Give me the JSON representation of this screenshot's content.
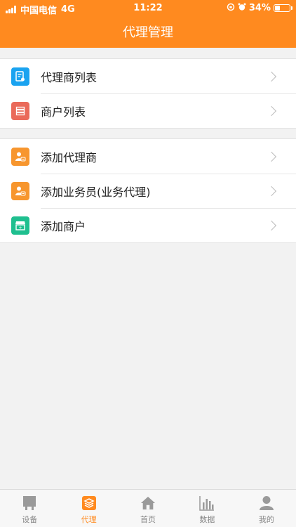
{
  "status_bar": {
    "carrier": "中国电信",
    "network": "4G",
    "time": "11:22",
    "battery": "34%",
    "battery_level": 0.34
  },
  "header": {
    "title": "代理管理"
  },
  "groups": [
    {
      "items": [
        {
          "label": "代理商列表",
          "icon": "agent-list-icon",
          "color": "#1aa3f0"
        },
        {
          "label": "商户列表",
          "icon": "merchant-list-icon",
          "color": "#ea6a5a"
        }
      ]
    },
    {
      "items": [
        {
          "label": "添加代理商",
          "icon": "add-agent-icon",
          "color": "#f7962e"
        },
        {
          "label": "添加业务员(业务代理)",
          "icon": "add-salesman-icon",
          "color": "#f7962e"
        },
        {
          "label": "添加商户",
          "icon": "add-merchant-icon",
          "color": "#1fbf8f"
        }
      ]
    }
  ],
  "tabbar": {
    "accent": "#ff8a1f",
    "tabs": [
      {
        "label": "设备",
        "icon": "device-icon"
      },
      {
        "label": "代理",
        "icon": "agent-icon",
        "active": true
      },
      {
        "label": "首页",
        "icon": "home-icon"
      },
      {
        "label": "数据",
        "icon": "data-icon"
      },
      {
        "label": "我的",
        "icon": "profile-icon"
      }
    ]
  }
}
